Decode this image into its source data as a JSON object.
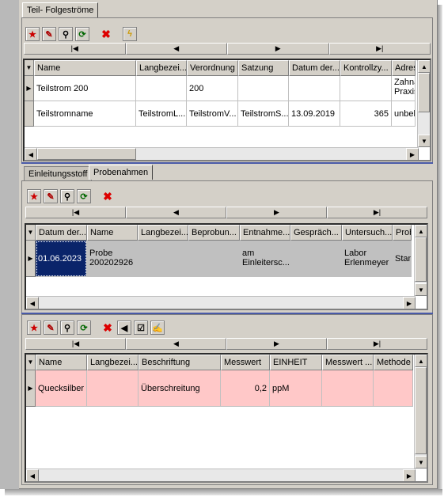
{
  "top_panel": {
    "tab": "Teil- Folgeströme",
    "nav": [
      "|◀",
      "◀",
      "▶",
      "▶|"
    ],
    "columns": [
      "Name",
      "Langbezei...",
      "Verordnung",
      "Satzung",
      "Datum der...",
      "Kontrollzy...",
      "Adresse"
    ],
    "rows": [
      [
        "Teilstrom 200",
        "",
        "200",
        "",
        "",
        "",
        "Zahnarzt Praxis"
      ],
      [
        "Teilstromname",
        "TeilstromL...",
        "TeilstromV...",
        "TeilstromS...",
        "13.09.2019",
        "365",
        "unbekannt"
      ]
    ]
  },
  "middle_panel": {
    "tabs": [
      "Einleitungsstoff",
      "Probenahmen"
    ],
    "nav": [
      "|◀",
      "◀",
      "▶",
      "▶|"
    ],
    "columns": [
      "Datum der...",
      "Name",
      "Langbezei...",
      "Beprobun...",
      "Entnahme...",
      "Gespräch...",
      "Untersuch...",
      "Probe"
    ],
    "rows": [
      [
        "01.06.2023",
        "Probe 200202926",
        "",
        "",
        "am Einleitersc...",
        "",
        "Labor Erlenmeyer",
        "Stan"
      ]
    ]
  },
  "bottom_panel": {
    "nav": [
      "|◀",
      "◀",
      "▶",
      "▶|"
    ],
    "columns": [
      "Name",
      "Langbezei...",
      "Beschriftung",
      "Messwert",
      "EINHEIT",
      "Messwert ...",
      "Methode"
    ],
    "rows": [
      [
        "Quecksilber",
        "",
        "Überschreitung",
        "0,2",
        "ppM",
        "",
        ""
      ]
    ]
  },
  "icons": {
    "add": "★",
    "edit": "✎",
    "search": "⚲",
    "refresh": "⟳",
    "delete": "✖",
    "lightning": "ϟ",
    "back": "◀",
    "check": "☑",
    "signature": "✍"
  },
  "colors": {
    "selected_row": "#ffc8c8",
    "selected_cell": "#0a246a",
    "row_gray": "#c0c0c0",
    "accent_line": "#4a5aa8"
  }
}
